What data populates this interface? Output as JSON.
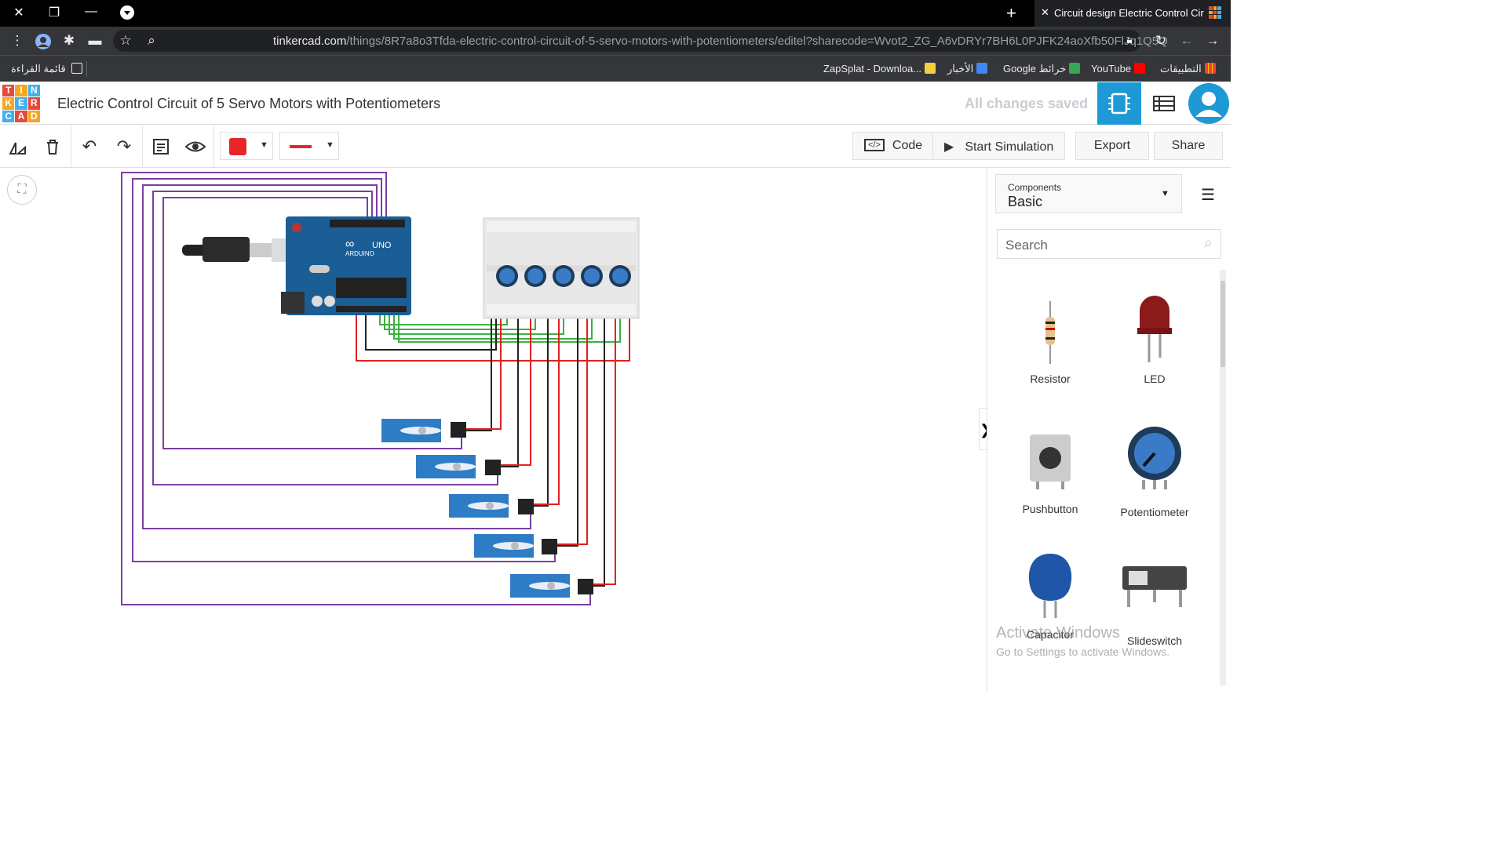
{
  "browser": {
    "tab_title": "Circuit design Electric Control Cir",
    "url_domain": "tinkercad.com",
    "url_path": "/things/8R7a8o3Tfda-electric-control-circuit-of-5-servo-motors-with-potentiometers/editel?sharecode=Wvot2_ZG_A6vDRYr7BH6L0PJFK24aoXfb50FlJq1Q5Q",
    "reading_list": "قائمة القراءة",
    "bookmarks": [
      "ZapSplat - Downloa...",
      "الأخبار",
      "Google خرائط",
      "YouTube",
      "التطبيقات"
    ]
  },
  "app": {
    "logo_letters": [
      "T",
      "I",
      "N",
      "K",
      "E",
      "R",
      "C",
      "A",
      "D"
    ],
    "title": "Electric Control Circuit of 5 Servo Motors with Potentiometers",
    "save_status": "All changes saved"
  },
  "toolbar": {
    "code_label": "Code",
    "simulate_label": "Start Simulation",
    "export_label": "Export",
    "share_label": "Share"
  },
  "panel": {
    "components_label": "Components",
    "components_value": "Basic",
    "search_placeholder": "Search",
    "items": [
      "Resistor",
      "LED",
      "Pushbutton",
      "Potentiometer",
      "Capacitor",
      "Slideswitch"
    ]
  },
  "arduino": {
    "brand": "ARDUINO",
    "model": "UNO"
  },
  "watermark": {
    "line1": "Activate Windows",
    "line2": "Go to Settings to activate Windows."
  },
  "colors": {
    "accent": "#1d9ad6",
    "wire_purple": "#7b3fa0",
    "wire_red": "#e02020",
    "wire_green": "#3cb043",
    "wire_black": "#222222",
    "fill_red": "#e8262a"
  }
}
